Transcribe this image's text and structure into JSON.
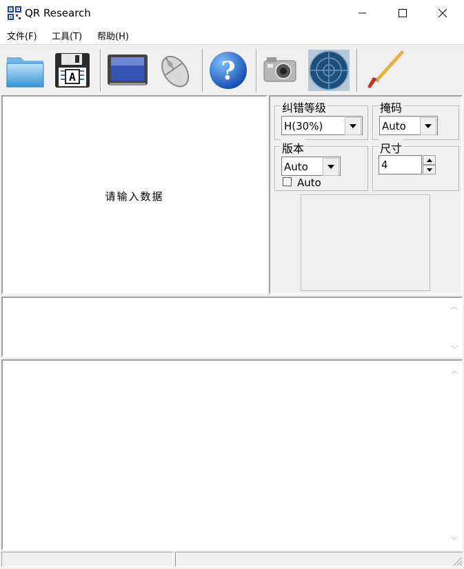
{
  "window": {
    "title": "QR Research"
  },
  "menu": {
    "file": "文件(F)",
    "tools": "工具(T)",
    "help": "帮助(H)"
  },
  "toolbar": {
    "buttons": [
      "folder-icon",
      "save-disk-icon",
      "monitor-icon",
      "mouse-icon",
      "help-icon",
      "camera-icon",
      "radar-icon",
      "brush-icon"
    ]
  },
  "input_panel": {
    "placeholder": "请输入数据"
  },
  "settings": {
    "ecc": {
      "label": "纠错等级",
      "value": "H(30%)"
    },
    "mask": {
      "label": "掩码",
      "value": "Auto"
    },
    "version": {
      "label": "版本",
      "value": "Auto",
      "checkbox_label": "Auto",
      "checked": false
    },
    "size": {
      "label": "尺寸",
      "value": "4"
    }
  },
  "colors": {
    "accent": "#0a64c8",
    "window_bg": "#f0f0f0"
  }
}
